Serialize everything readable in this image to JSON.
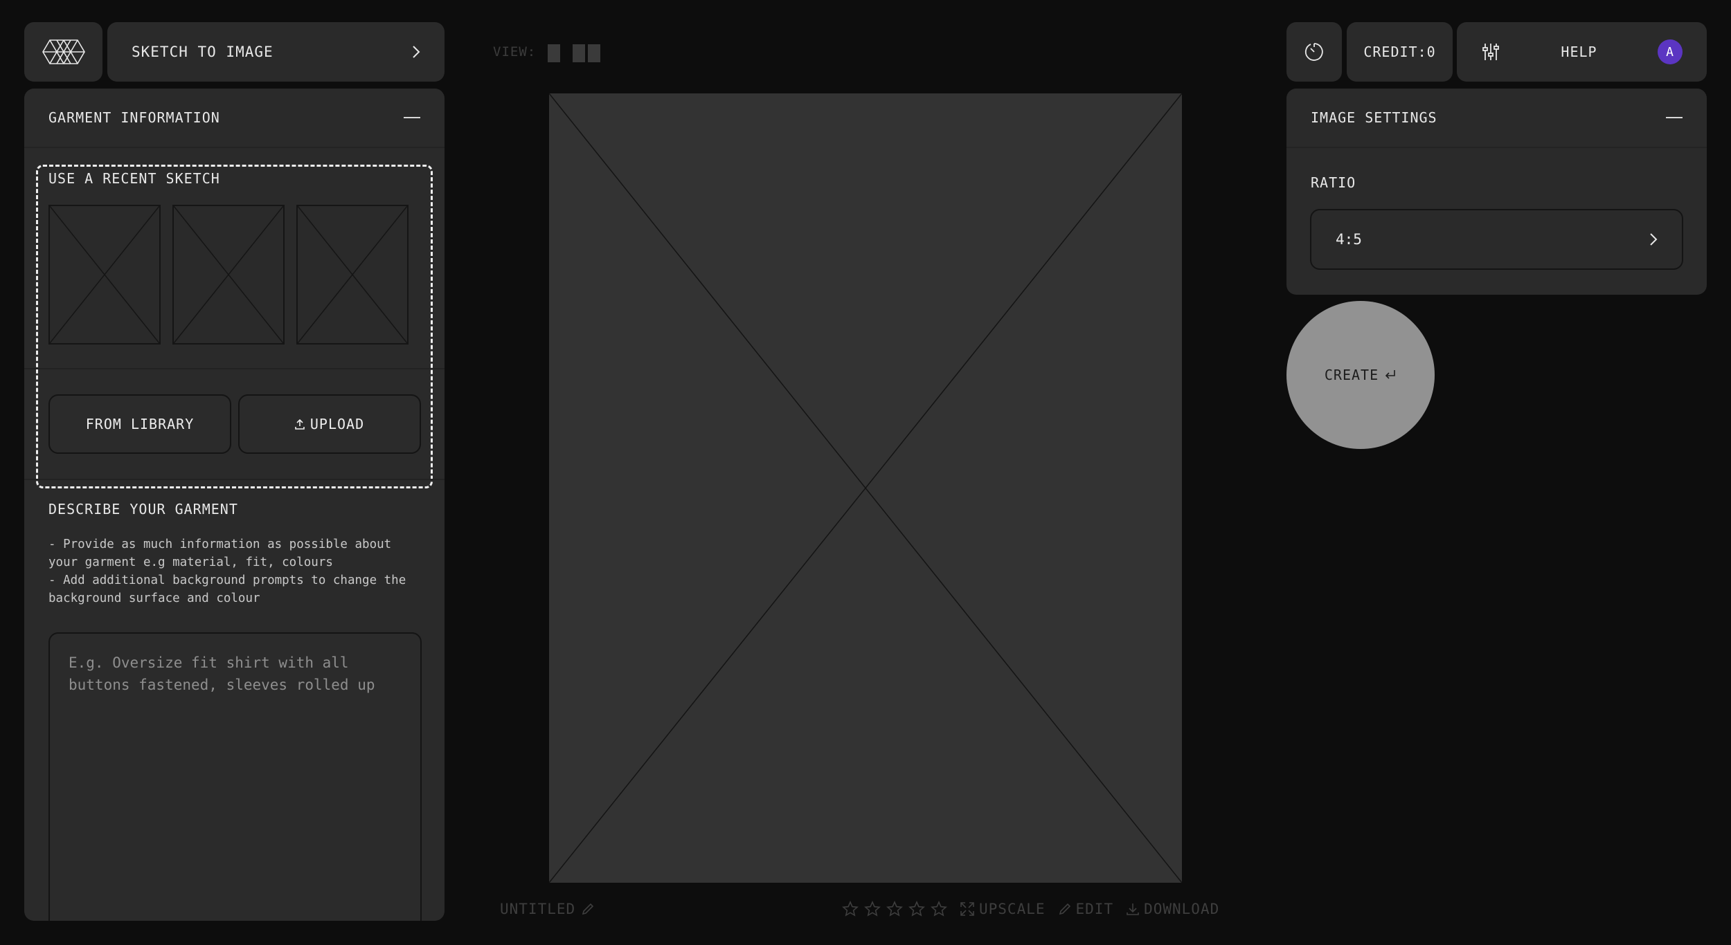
{
  "app": {
    "logo_icon": "hexagon-logo-icon"
  },
  "mode_selector": {
    "label": "SKETCH TO IMAGE",
    "icon": "chevron-right-icon"
  },
  "garment_panel": {
    "title": "GARMENT INFORMATION",
    "recent_sketch": {
      "title": "USE A RECENT SKETCH"
    },
    "from_library_label": "FROM LIBRARY",
    "upload_label": "UPLOAD",
    "describe": {
      "title": "DESCRIBE YOUR GARMENT",
      "tip1": "- Provide as much information as possible about your garment e.g material, fit, colours",
      "tip2": "- Add additional background prompts to change the background surface and colour",
      "placeholder": "E.g. Oversize fit shirt with all buttons fastened, sleeves rolled up"
    }
  },
  "canvas": {
    "view_label": "VIEW:",
    "title": "UNTITLED",
    "rating": {
      "value": 0,
      "max": 5
    },
    "actions": {
      "upscale": "UPSCALE",
      "edit": "EDIT",
      "download": "DOWNLOAD"
    }
  },
  "top_right": {
    "credit_label": "CREDIT:0",
    "help_label": "HELP",
    "avatar_initial": "A",
    "avatar_color": "#5b35c2"
  },
  "image_settings": {
    "title": "IMAGE SETTINGS",
    "ratio_label": "RATIO",
    "ratio_value": "4:5"
  },
  "create_button": {
    "label": "CREATE"
  }
}
